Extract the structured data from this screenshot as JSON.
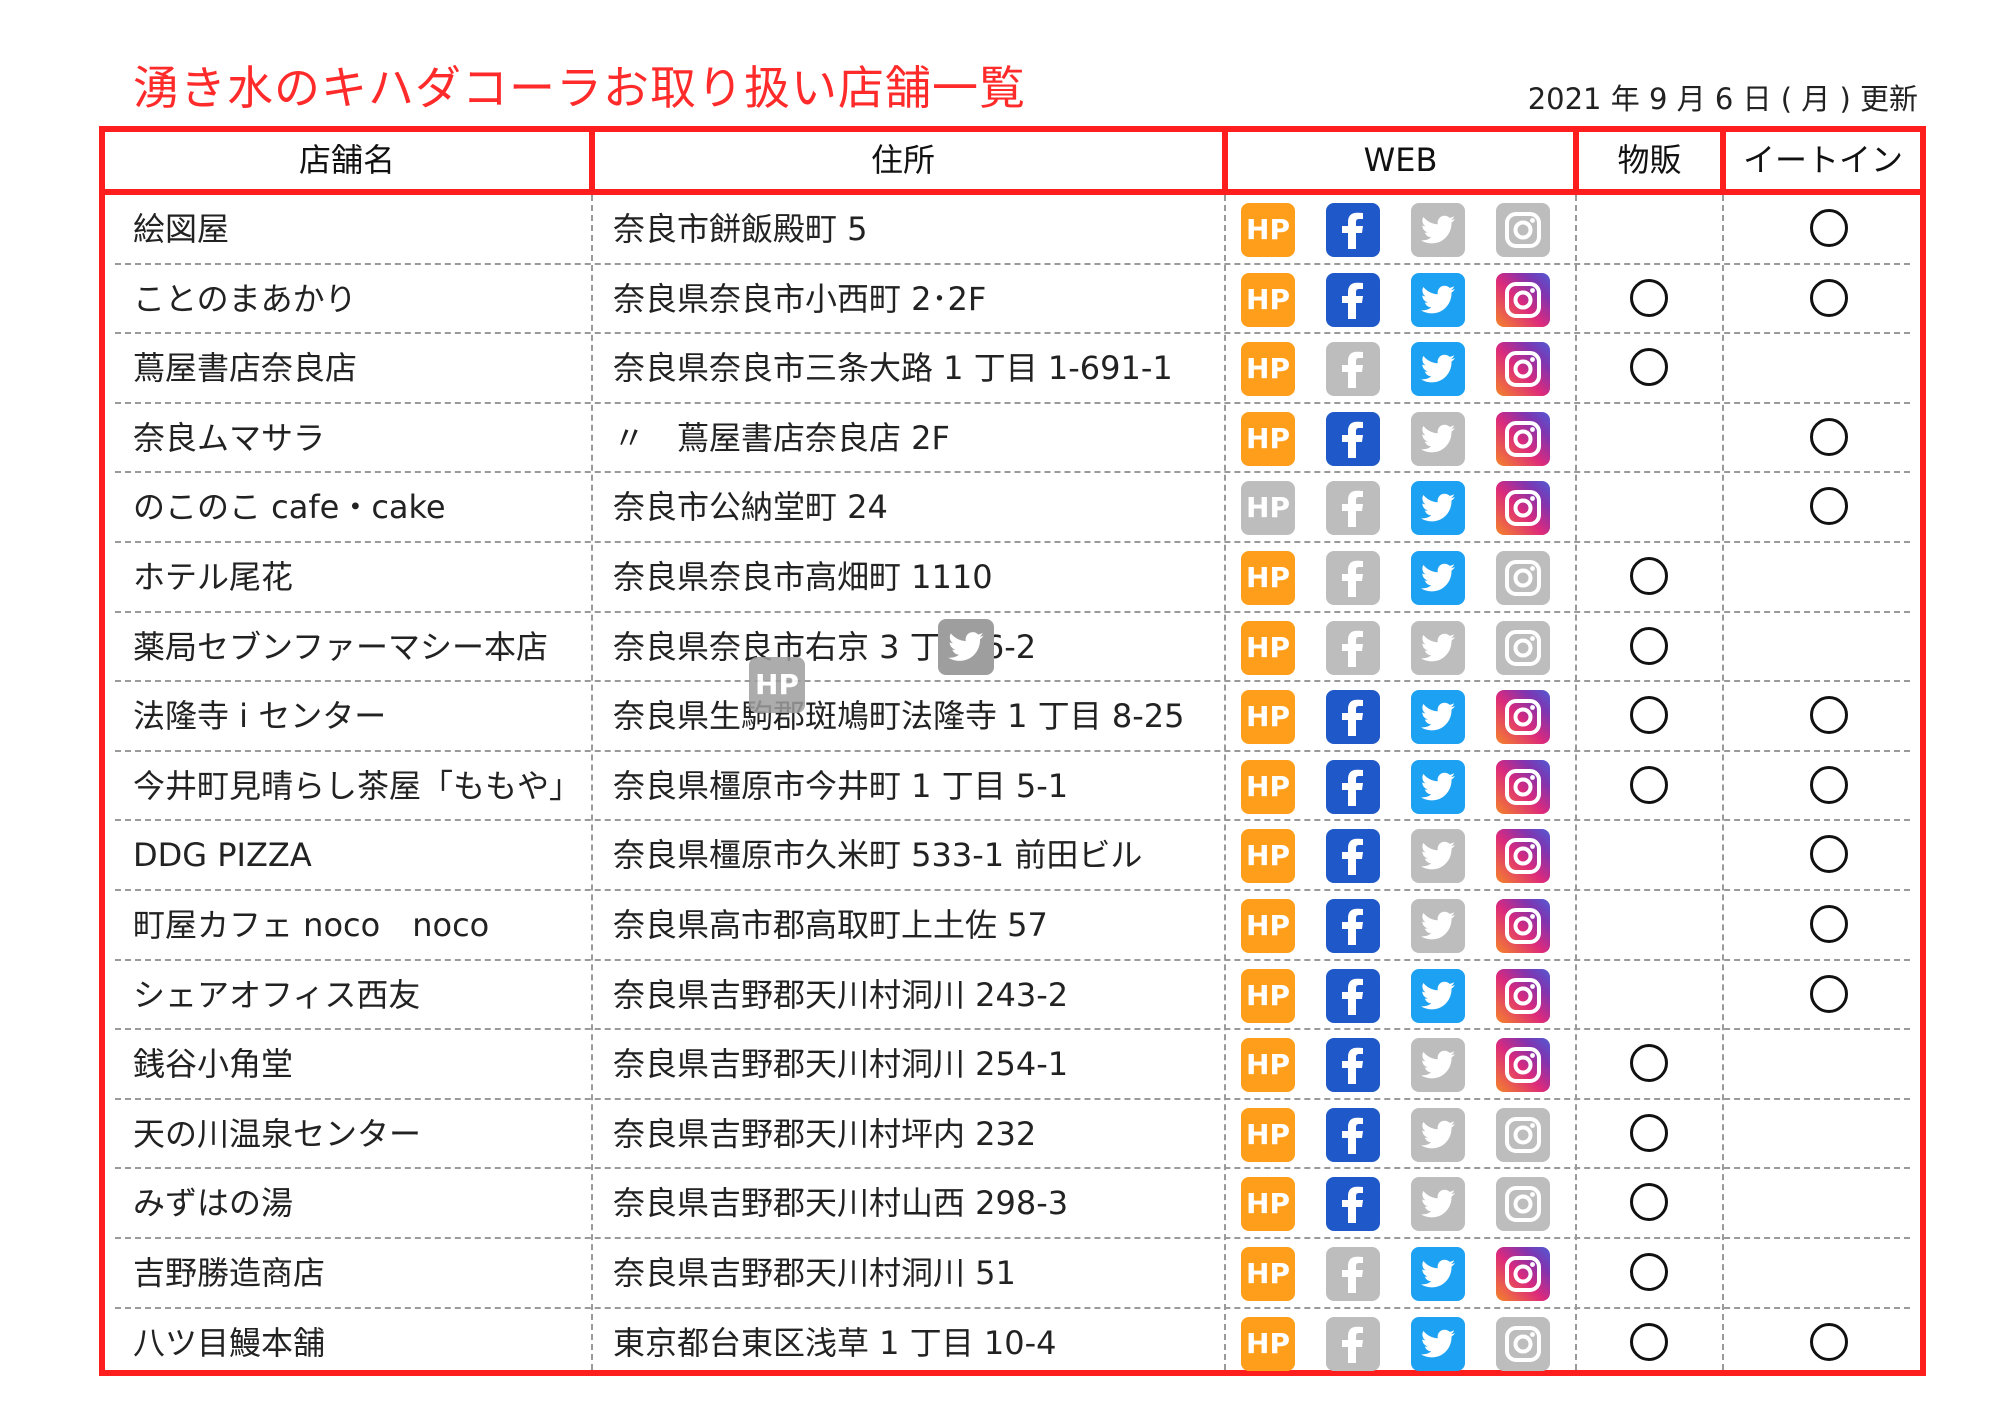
{
  "title": "湧き水のキハダコーラお取り扱い店舗一覧",
  "updated": "2021 年 9 月 6 日 ( 月 ) 更新",
  "columns": {
    "name": "店舗名",
    "address": "住所",
    "web": "WEB",
    "retail": "物販",
    "eat_in": "イートイン"
  },
  "icons": {
    "hp": "hp-icon",
    "facebook": "facebook-icon",
    "twitter": "twitter-icon",
    "instagram": "instagram-icon",
    "hp_label": "HP"
  },
  "colors": {
    "title": "#ff2a2a",
    "border": "#ff1e1e",
    "hp": "#ff9e1b",
    "facebook": "#1f58c8",
    "twitter": "#1da1f2",
    "inactive": "#bdbdbd"
  },
  "stores": [
    {
      "name": "絵図屋",
      "address": "奈良市餅飯殿町 5",
      "hp": true,
      "facebook": true,
      "twitter": false,
      "instagram": false,
      "retail": false,
      "eat_in": true
    },
    {
      "name": "ことのまあかり",
      "address": "奈良県奈良市小西町 2･2F",
      "hp": true,
      "facebook": true,
      "twitter": true,
      "instagram": true,
      "retail": true,
      "eat_in": true
    },
    {
      "name": "蔦屋書店奈良店",
      "address": "奈良県奈良市三条大路 1 丁目 1-691-1",
      "hp": true,
      "facebook": false,
      "twitter": true,
      "instagram": true,
      "retail": true,
      "eat_in": false
    },
    {
      "name": "奈良ムマサラ",
      "address": "〃　蔦屋書店奈良店 2F",
      "hp": true,
      "facebook": true,
      "twitter": false,
      "instagram": true,
      "retail": false,
      "eat_in": true
    },
    {
      "name": "のこのこ cafe・cake",
      "address": "奈良市公納堂町 24",
      "hp": false,
      "facebook": false,
      "twitter": true,
      "instagram": true,
      "retail": false,
      "eat_in": true
    },
    {
      "name": "ホテル尾花",
      "address": "奈良県奈良市高畑町 1110",
      "hp": true,
      "facebook": false,
      "twitter": true,
      "instagram": false,
      "retail": true,
      "eat_in": false
    },
    {
      "name": "薬局セブンファーマシー本店",
      "address": "奈良県奈良市右京 3 丁目 6-2",
      "hp": true,
      "facebook": false,
      "twitter": false,
      "instagram": false,
      "retail": true,
      "eat_in": false
    },
    {
      "name": "法隆寺 i センター",
      "address": "奈良県生駒郡斑鳩町法隆寺 1 丁目 8-25",
      "hp": true,
      "facebook": true,
      "twitter": true,
      "instagram": true,
      "retail": true,
      "eat_in": true
    },
    {
      "name": "今井町見晴らし茶屋「ももや」",
      "address": "奈良県橿原市今井町 1 丁目 5-1",
      "hp": true,
      "facebook": true,
      "twitter": true,
      "instagram": true,
      "retail": true,
      "eat_in": true
    },
    {
      "name": "DDG PIZZA",
      "address": "奈良県橿原市久米町 533-1 前田ビル",
      "hp": true,
      "facebook": true,
      "twitter": false,
      "instagram": true,
      "retail": false,
      "eat_in": true
    },
    {
      "name": "町屋カフェ noco　noco",
      "address": "奈良県高市郡高取町上土佐 57",
      "hp": true,
      "facebook": true,
      "twitter": false,
      "instagram": true,
      "retail": false,
      "eat_in": true
    },
    {
      "name": "シェアオフィス西友",
      "address": "奈良県吉野郡天川村洞川 243-2",
      "hp": true,
      "facebook": true,
      "twitter": true,
      "instagram": true,
      "retail": false,
      "eat_in": true
    },
    {
      "name": "銭谷小角堂",
      "address": "奈良県吉野郡天川村洞川 254-1",
      "hp": true,
      "facebook": true,
      "twitter": false,
      "instagram": true,
      "retail": true,
      "eat_in": false
    },
    {
      "name": "天の川温泉センター",
      "address": "奈良県吉野郡天川村坪内 232",
      "hp": true,
      "facebook": true,
      "twitter": false,
      "instagram": false,
      "retail": true,
      "eat_in": false
    },
    {
      "name": "みずはの湯",
      "address": "奈良県吉野郡天川村山西 298-3",
      "hp": true,
      "facebook": true,
      "twitter": false,
      "instagram": false,
      "retail": true,
      "eat_in": false
    },
    {
      "name": "吉野勝造商店",
      "address": "奈良県吉野郡天川村洞川 51",
      "hp": true,
      "facebook": false,
      "twitter": true,
      "instagram": true,
      "retail": true,
      "eat_in": false
    },
    {
      "name": "八ツ目鰻本舗",
      "address": "東京都台東区浅草 1 丁目 10-4",
      "hp": true,
      "facebook": false,
      "twitter": true,
      "instagram": false,
      "retail": true,
      "eat_in": true
    }
  ]
}
